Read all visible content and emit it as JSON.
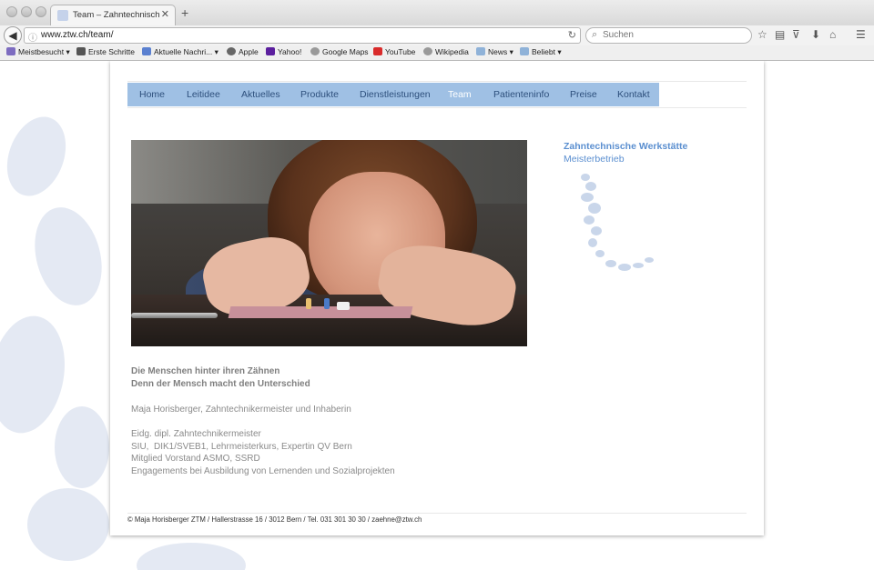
{
  "browser": {
    "tab_title": "Team – Zahntechnische W...",
    "url": "www.ztw.ch/team/",
    "search_placeholder": "Suchen",
    "bookmarks": [
      "Meistbesucht",
      "Erste Schritte",
      "Aktuelle Nachri...",
      "Apple",
      "Yahoo!",
      "Google Maps",
      "YouTube",
      "Wikipedia",
      "News",
      "Beliebt"
    ]
  },
  "nav": {
    "items": [
      "Home",
      "Leitidee",
      "Aktuelles",
      "Produkte",
      "Dienstleistungen",
      "Team",
      "Patienteninfo",
      "Preise",
      "Kontakt"
    ],
    "active": "Team"
  },
  "sidebar": {
    "title": "Zahntechnische Werkstätte",
    "subtitle": "Meisterbetrieb"
  },
  "content": {
    "heading_1": "Die Menschen hinter ihren Zähnen",
    "heading_2": "Denn der Mensch macht den Unterschied",
    "person": "Maja Horisberger, Zahntechnikermeister und Inhaberin",
    "qualifications": [
      "Eidg. dipl. Zahntechnikermeister",
      "SIU,  DIK1/SVEB1, Lehrmeisterkurs, Expertin QV Bern",
      "Mitglied Vorstand ASMO, SSRD",
      "Engagements bei Ausbildung von Lernenden und Sozialprojekten"
    ]
  },
  "footer": {
    "text": "© Maja Horisberger ZTM / Hallerstrasse 16 / 3012 Bern / Tel. 031 301 30 30 / zaehne@ztw.ch"
  },
  "colors": {
    "nav_bg": "#9fc0e4",
    "nav_text": "#2d4f7c",
    "accent": "#5b8fd0"
  }
}
